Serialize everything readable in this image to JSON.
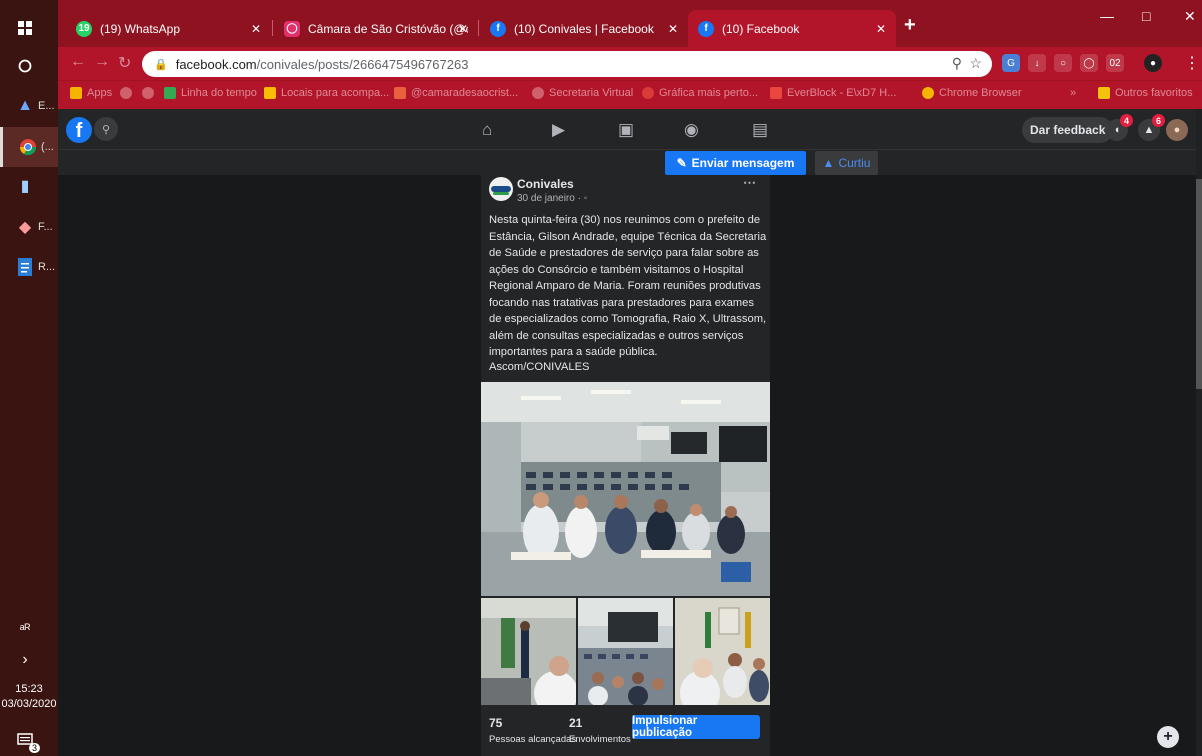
{
  "taskbar": {
    "items": [
      {
        "label": "",
        "icon": "windows-start-icon"
      },
      {
        "label": "",
        "icon": "cortana-icon"
      },
      {
        "label": "E...",
        "icon": "app-icon"
      },
      {
        "label": "(...",
        "icon": "chrome-icon"
      },
      {
        "label": "",
        "icon": "app-icon"
      },
      {
        "label": "F...",
        "icon": "app-icon"
      },
      {
        "label": "R...",
        "icon": "document-icon"
      }
    ],
    "time": "15:23",
    "date": "03/03/2020",
    "notification_count": "3"
  },
  "browser": {
    "tabs": [
      {
        "title": "(19) WhatsApp",
        "favicon": "19"
      },
      {
        "title": "Câmara de São Cristóvão (@cam",
        "favicon": "ig"
      },
      {
        "title": "(10) Conivales | Facebook",
        "favicon": "f"
      },
      {
        "title": "(10) Facebook",
        "favicon": "f"
      }
    ],
    "url_domain": "facebook.com",
    "url_path": "/conivales/posts/2666475496767263",
    "bookmarks": [
      "Apps",
      "Linha do tempo",
      "Locais para acompa...",
      "@camaradesaocrist...",
      "Secretaria Virtual",
      "Gráfica mais perto...",
      "EverBlock - E\\xD7 H...",
      "Chrome Browser",
      "Outros favoritos"
    ],
    "accent_color": "#b2142a"
  },
  "facebook": {
    "feedback_label": "Dar feedback",
    "messenger_badge": "4",
    "notif_badge": "6",
    "send_message_label": "Enviar mensagem",
    "liked_label": "Curtiu",
    "post": {
      "author": "Conivales",
      "date": "30 de janeiro · ",
      "text": "Nesta quinta-feira (30) nos reunimos com o prefeito de Estância, Gilson Andrade,  equipe Técnica da Secretaria de Saúde e prestadores de serviço para falar sobre as ações do Consórcio e também visitamos o Hospital Regional Amparo de Maria. Foram reuniões produtivas focando nas tratativas  para prestadores para exames de especializados como  Tomografia, Raio X, Ultrassom, além de consultas especializadas e outros serviços importantes para a saúde pública.",
      "signature": "Ascom/CONIVALES",
      "people_reached": "75",
      "people_reached_label": "Pessoas alcançadas",
      "engagements": "21",
      "engagements_label": "Envolvimentos",
      "boost_label": "Impulsionar publicação"
    }
  }
}
